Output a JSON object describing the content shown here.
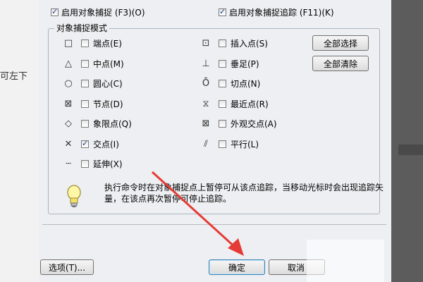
{
  "background": {
    "left_text": "可左下",
    "accent": "#e53b36"
  },
  "dialog": {
    "enable_snap": "启用对象捕捉 (F3)(O)",
    "enable_track": "启用对象捕捉追踪 (F11)(K)",
    "group_title": "对象捕捉模式",
    "modes_left": [
      {
        "icon": "square-icon",
        "glyph": "□",
        "label": "端点(E)",
        "checked": false
      },
      {
        "icon": "triangle-icon",
        "glyph": "△",
        "label": "中点(M)",
        "checked": false
      },
      {
        "icon": "circle-icon",
        "glyph": "○",
        "label": "圆心(C)",
        "checked": false
      },
      {
        "icon": "node-icon",
        "glyph": "⊠",
        "label": "节点(D)",
        "checked": false
      },
      {
        "icon": "diamond-icon",
        "glyph": "◇",
        "label": "象限点(Q)",
        "checked": false
      },
      {
        "icon": "cross-icon",
        "glyph": "✕",
        "label": "交点(I)",
        "checked": true
      },
      {
        "icon": "extension-icon",
        "glyph": "┄",
        "label": "延伸(X)",
        "checked": false
      }
    ],
    "modes_right": [
      {
        "icon": "insert-icon",
        "glyph": "⊡",
        "label": "插入点(S)",
        "checked": false
      },
      {
        "icon": "perpendicular-icon",
        "glyph": "⊥",
        "label": "垂足(P)",
        "checked": false
      },
      {
        "icon": "tangent-icon",
        "glyph": "Ō",
        "label": "切点(N)",
        "checked": false
      },
      {
        "icon": "nearest-icon",
        "glyph": "⧖",
        "label": "最近点(R)",
        "checked": false
      },
      {
        "icon": "apparent-intersection-icon",
        "glyph": "⊠",
        "label": "外观交点(A)",
        "checked": false
      },
      {
        "icon": "parallel-icon",
        "glyph": "⫽",
        "label": "平行(L)",
        "checked": false
      }
    ],
    "select_all": "全部选择",
    "clear_all": "全部清除",
    "info_text": "执行命令时在对象捕捉点上暂停可从该点追踪，当移动光标时会出现追踪矢量，在该点再次暂停可停止追踪。",
    "options_button": "选项(T)...",
    "ok_button": "确定",
    "cancel_button": "取消"
  }
}
